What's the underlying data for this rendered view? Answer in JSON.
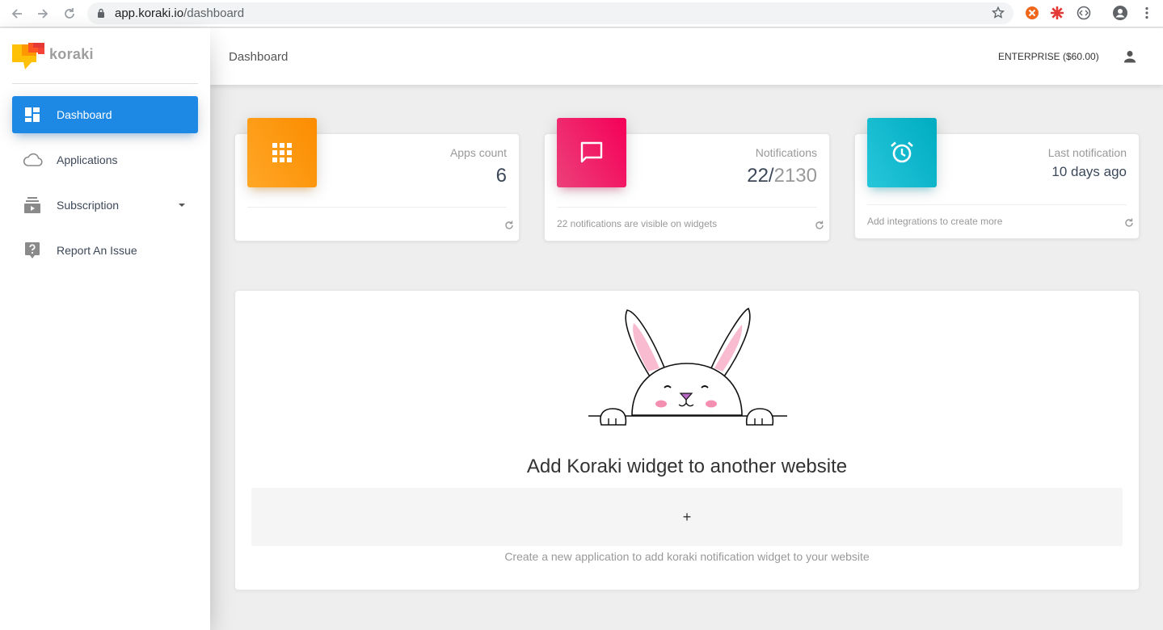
{
  "browser": {
    "url_host": "app.koraki.io",
    "url_path": "/dashboard"
  },
  "sidebar": {
    "logo_text": "koraki",
    "items": [
      {
        "label": "Dashboard",
        "icon": "dashboard-icon",
        "active": true
      },
      {
        "label": "Applications",
        "icon": "cloud-icon"
      },
      {
        "label": "Subscription",
        "icon": "subscriptions-icon",
        "has_dropdown": true
      },
      {
        "label": "Report An Issue",
        "icon": "help-icon"
      }
    ]
  },
  "header": {
    "title": "Dashboard",
    "plan": "ENTERPRISE ($60.00)"
  },
  "cards": {
    "apps": {
      "category": "Apps count",
      "value": "6",
      "icon": "apps-grid-icon",
      "color": "#fb8c00"
    },
    "notifications": {
      "category": "Notifications",
      "value_used": "22/",
      "value_total": "2130",
      "footer": "22 notifications are visible on widgets",
      "icon": "chat-icon",
      "color": "#e91e63"
    },
    "last": {
      "category": "Last notification",
      "value": "10 days ago",
      "footer": "Add integrations to create more",
      "icon": "alarm-icon",
      "color": "#00acc1"
    }
  },
  "widget": {
    "title": "Add Koraki widget to another website",
    "add_symbol": "+",
    "hint": "Create a new application to add koraki notification widget to your website"
  },
  "colors": {
    "primary": "#1e88e5",
    "orange": "#fb8c00",
    "pink": "#e91e63",
    "cyan": "#00acc1"
  }
}
